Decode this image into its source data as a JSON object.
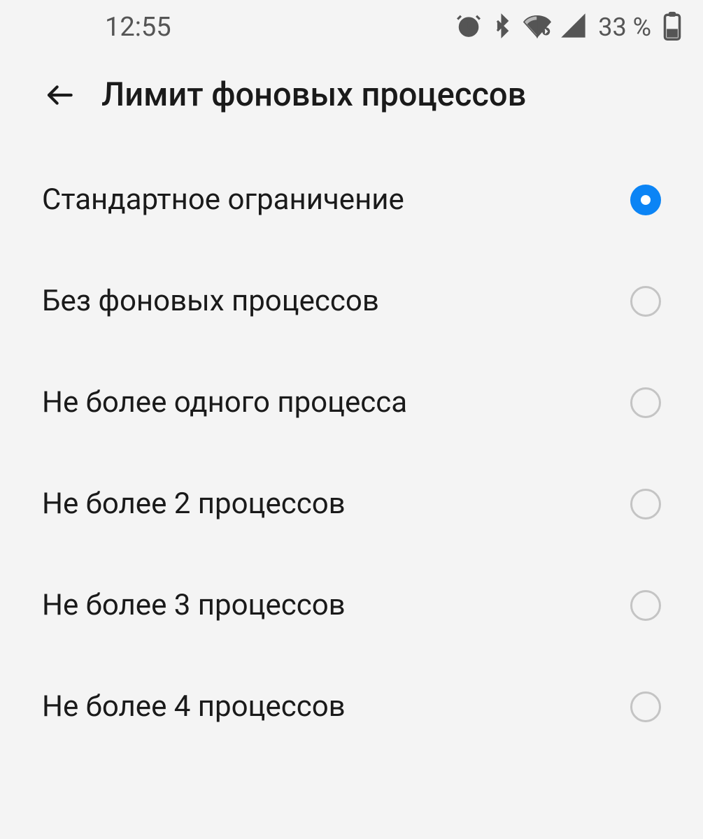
{
  "status": {
    "time": "12:55",
    "battery_percent": "33 %"
  },
  "header": {
    "title": "Лимит фоновых процессов"
  },
  "options": [
    {
      "label": "Стандартное ограничение",
      "selected": true
    },
    {
      "label": "Без фоновых процессов",
      "selected": false
    },
    {
      "label": "Не более одного процесса",
      "selected": false
    },
    {
      "label": "Не более 2 процессов",
      "selected": false
    },
    {
      "label": "Не более 3 процессов",
      "selected": false
    },
    {
      "label": "Не более 4 процессов",
      "selected": false
    }
  ]
}
